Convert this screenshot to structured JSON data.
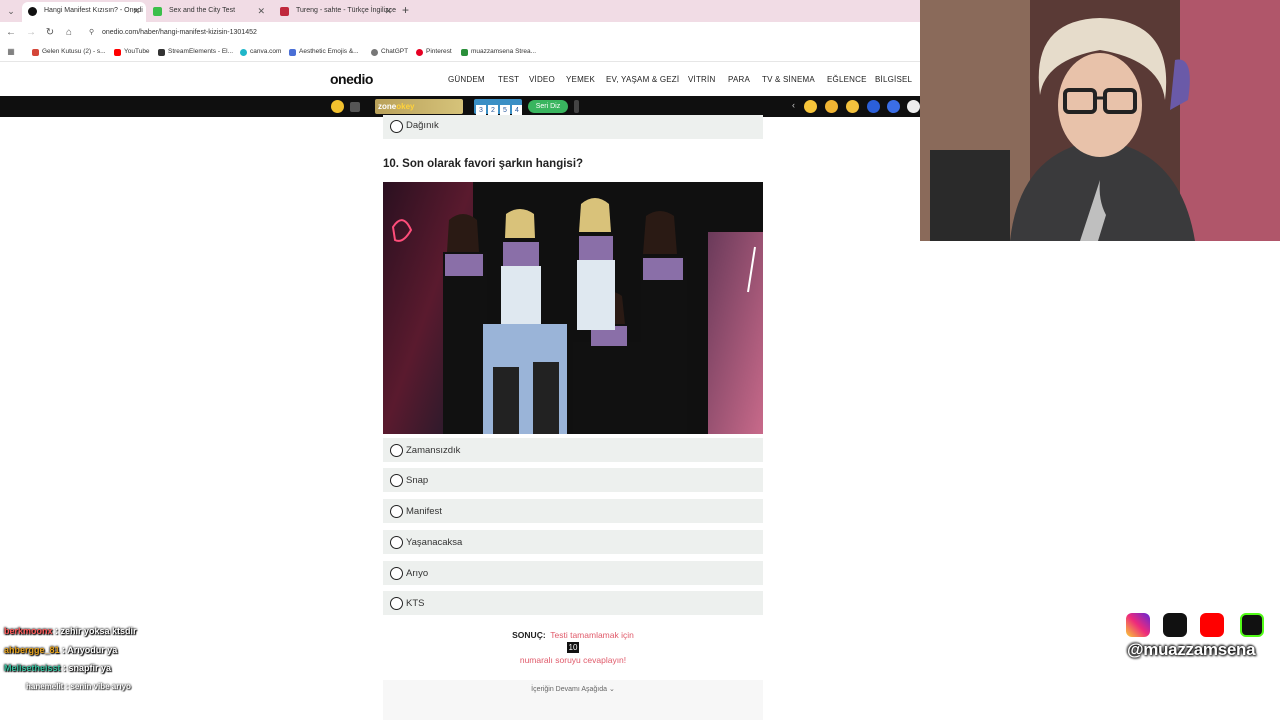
{
  "browser": {
    "tabs": [
      {
        "title": "Hangi Manifest Kızısın? - Onedi",
        "active": true
      },
      {
        "title": "Sex and the City Test",
        "active": false
      },
      {
        "title": "Tureng - sahte - Türkçe İngilizce",
        "active": false
      }
    ],
    "url": "onedio.com/haber/hangi-manifest-kizisin-1301452",
    "bookmarks": [
      "Gelen Kutusu (2) - s...",
      "YouTube",
      "StreamElements - El...",
      "canva.com",
      "Aesthetic Emojis &...",
      "ChatGPT",
      "Pinterest",
      "muazzamsena Strea..."
    ]
  },
  "site": {
    "logo": "onedio",
    "nav": [
      "GÜNDEM",
      "TEST",
      "VİDEO",
      "YEMEK",
      "EV, YAŞAM & GEZİ",
      "VİTRİN",
      "PARA",
      "TV & SİNEMA",
      "EĞLENCE",
      "BİLGİSEL"
    ]
  },
  "promo": {
    "zone": "zone",
    "okey": "okey",
    "tiles": [
      "3",
      "2",
      "5",
      "4"
    ],
    "seri_label": "Seri Diz"
  },
  "quiz": {
    "prev_option": "Dağınık",
    "question": "10. Son olarak favori şarkın hangisi?",
    "options": [
      "Zamansızdık",
      "Snap",
      "Manifest",
      "Yaşanacaksa",
      "Arıyo",
      "KTS"
    ],
    "result_label": "SONUÇ:",
    "result_msg_1": "Testi tamamlamak için",
    "result_num": "10",
    "result_msg_2": "numaralı soruyu cevaplayın!",
    "more_label": "İçeriğin Devamı Aşağıda"
  },
  "chat": [
    {
      "user": "berkmoonx",
      "text": "zehir yoksa ktsdir",
      "color": "#ff5b5b"
    },
    {
      "user": "ahbergge_81",
      "text": "Arıyodur ya",
      "color": "#e6a21c"
    },
    {
      "user": "Melisetheisst",
      "text": "snapfir ya",
      "color": "#37c3a0"
    },
    {
      "user": "hanemelit",
      "text": "senin vibe arıyo",
      "color": "#ffffff"
    }
  ],
  "stream": {
    "handle": "@muazzamsena",
    "socials": [
      "instagram-icon",
      "tiktok-icon",
      "youtube-icon",
      "kick-icon"
    ]
  }
}
